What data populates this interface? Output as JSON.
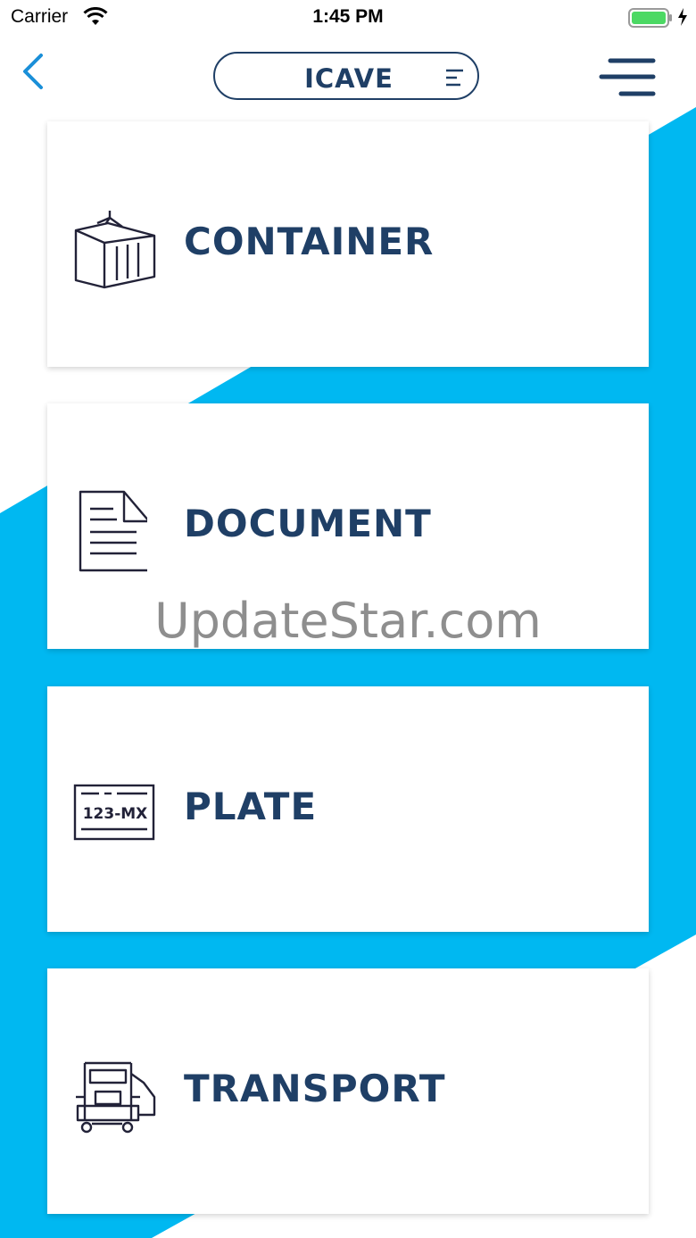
{
  "status_bar": {
    "carrier": "Carrier",
    "time": "1:45 PM",
    "battery_color": "#4cd964"
  },
  "nav": {
    "back_icon": "chevron-left-icon",
    "title": "ICAVE",
    "title_menu_icon": "list-icon",
    "menu_icon": "hamburger-icon"
  },
  "cards": [
    {
      "label": "CONTAINER",
      "icon": "container-icon"
    },
    {
      "label": "DOCUMENT",
      "icon": "document-icon"
    },
    {
      "label": "PLATE",
      "icon": "plate-icon",
      "plate_text": "123-MX"
    },
    {
      "label": "TRANSPORT",
      "icon": "truck-icon"
    }
  ],
  "watermark": "UpdateStar.com",
  "colors": {
    "accent": "#00b8f1",
    "text": "#1f3f66",
    "icon_stroke": "#222238"
  }
}
